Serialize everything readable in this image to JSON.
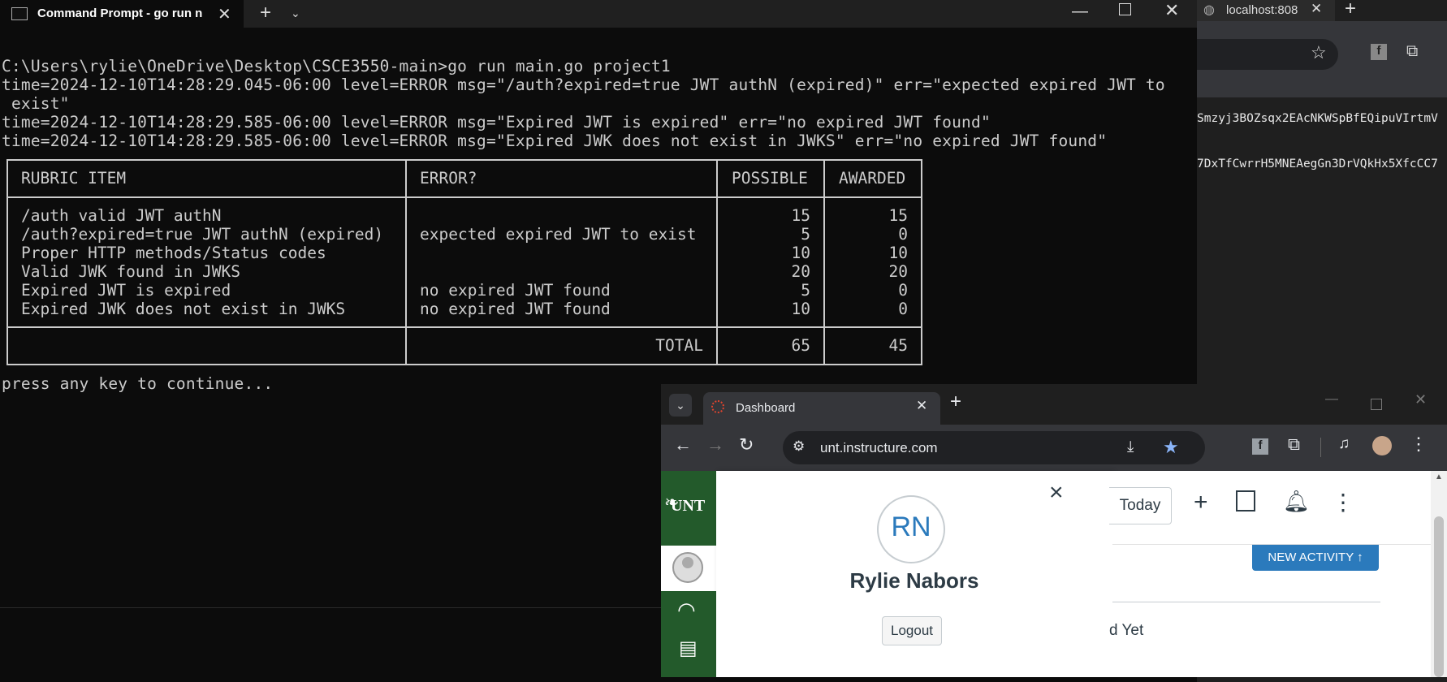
{
  "terminal": {
    "tab_title": "Command Prompt - go  run n",
    "lines": [
      "C:\\Users\\rylie\\OneDrive\\Desktop\\CSCE3550-main>go run main.go project1",
      "time=2024-12-10T14:28:29.045-06:00 level=ERROR msg=\"/auth?expired=true JWT authN (expired)\" err=\"expected expired JWT to",
      " exist\"",
      "time=2024-12-10T14:28:29.585-06:00 level=ERROR msg=\"Expired JWT is expired\" err=\"no expired JWT found\"",
      "time=2024-12-10T14:28:29.585-06:00 level=ERROR msg=\"Expired JWK does not exist in JWKS\" err=\"no expired JWT found\""
    ],
    "table": {
      "headers": [
        "RUBRIC ITEM",
        "ERROR?",
        "POSSIBLE",
        "AWARDED"
      ],
      "rows": [
        {
          "item": "/auth valid JWT authN",
          "error": "",
          "possible": "15",
          "awarded": "15"
        },
        {
          "item": "/auth?expired=true JWT authN (expired)",
          "error": "expected expired JWT to exist",
          "possible": "5",
          "awarded": "0"
        },
        {
          "item": "Proper HTTP methods/Status codes",
          "error": "",
          "possible": "10",
          "awarded": "10"
        },
        {
          "item": "Valid JWK found in JWKS",
          "error": "",
          "possible": "20",
          "awarded": "20"
        },
        {
          "item": "Expired JWT is expired",
          "error": "no expired JWT found",
          "possible": "5",
          "awarded": "0"
        },
        {
          "item": "Expired JWK does not exist in JWKS",
          "error": "no expired JWT found",
          "possible": "10",
          "awarded": "0"
        }
      ],
      "total_label": "TOTAL",
      "total_possible": "65",
      "total_awarded": "45"
    },
    "prompt_line": "press any key to continue..."
  },
  "bg_browser": {
    "tab_title": "localhost:808",
    "text_line1": "Smzyj3BOZsqx2EAcNKWSpBfEQipuVIrtmV",
    "text_line2": "7DxTfCwrrH5MNEAegGn3DrVQkHx5XfcCC7"
  },
  "chrome": {
    "tab_title": "Dashboard",
    "url": "unt.instructure.com",
    "nav_logo": "UNT",
    "tray": {
      "initials": "RN",
      "name": "Rylie Nabors",
      "logout": "Logout",
      "close": "×"
    },
    "dashboard": {
      "today_button": "Today",
      "new_activity": "NEW ACTIVITY ↑",
      "partial_text": "d Yet"
    }
  }
}
